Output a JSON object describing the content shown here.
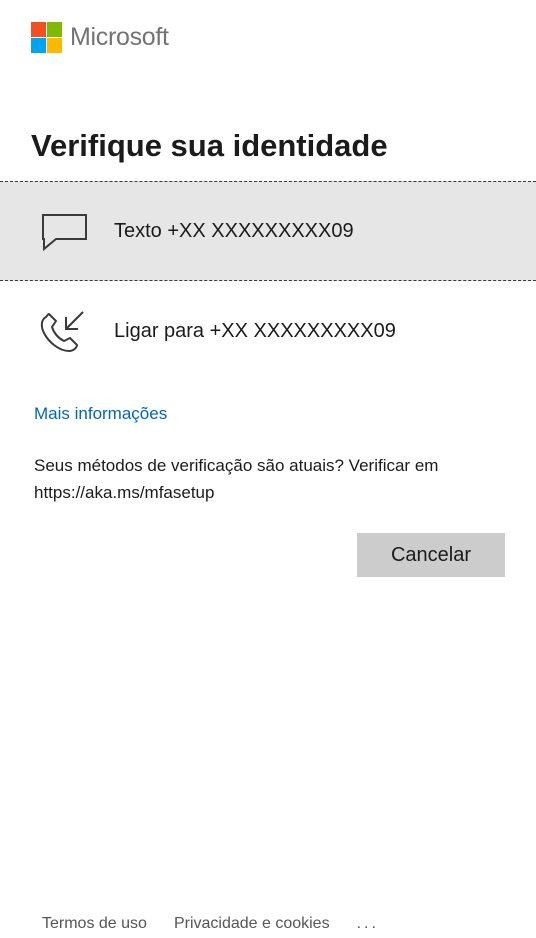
{
  "brand": {
    "name": "Microsoft",
    "logo_colors": [
      "#f25022",
      "#7fba00",
      "#00a4ef",
      "#ffb900"
    ]
  },
  "heading": "Verifique sua identidade",
  "options": [
    {
      "icon": "message-icon",
      "label": "Texto +XX XXXXXXXXX09",
      "selected": true
    },
    {
      "icon": "phone-call-icon",
      "label": "Ligar para +XX XXXXXXXXX09",
      "selected": false
    }
  ],
  "more_info_link": "Mais informações",
  "info_text": "Seus métodos de verificação são atuais? Verificar em https://aka.ms/mfasetup",
  "cancel_label": "Cancelar",
  "footer": {
    "terms": "Termos de uso",
    "privacy": "Privacidade e cookies",
    "more": "..."
  },
  "colors": {
    "link": "#0067b8",
    "selected_bg": "#e6e6e6",
    "button_bg": "#cccccc"
  }
}
